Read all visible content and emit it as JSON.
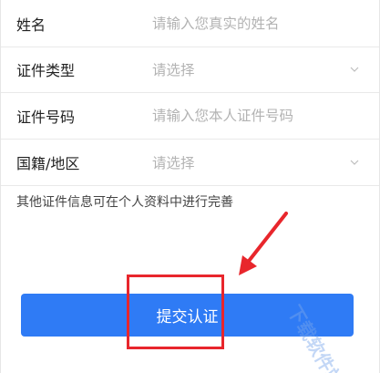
{
  "form": {
    "rows": [
      {
        "label": "姓名",
        "type": "input",
        "placeholder": "请输入您真实的姓名",
        "value": ""
      },
      {
        "label": "证件类型",
        "type": "select",
        "value": "请选择"
      },
      {
        "label": "证件号码",
        "type": "input",
        "placeholder": "请输入您本人证件号码",
        "value": ""
      },
      {
        "label": "国籍/地区",
        "type": "select",
        "value": "请选择"
      }
    ],
    "hint": "其他证件信息可在个人资料中进行完善"
  },
  "submit": {
    "label": "提交认证"
  },
  "watermark": {
    "text": "下载软件站"
  },
  "colors": {
    "accent": "#2f7bf5",
    "annotation": "#e8262c",
    "placeholder": "#b3b3b3"
  },
  "icons": {
    "select_indicator": "chevron-down-icon"
  }
}
